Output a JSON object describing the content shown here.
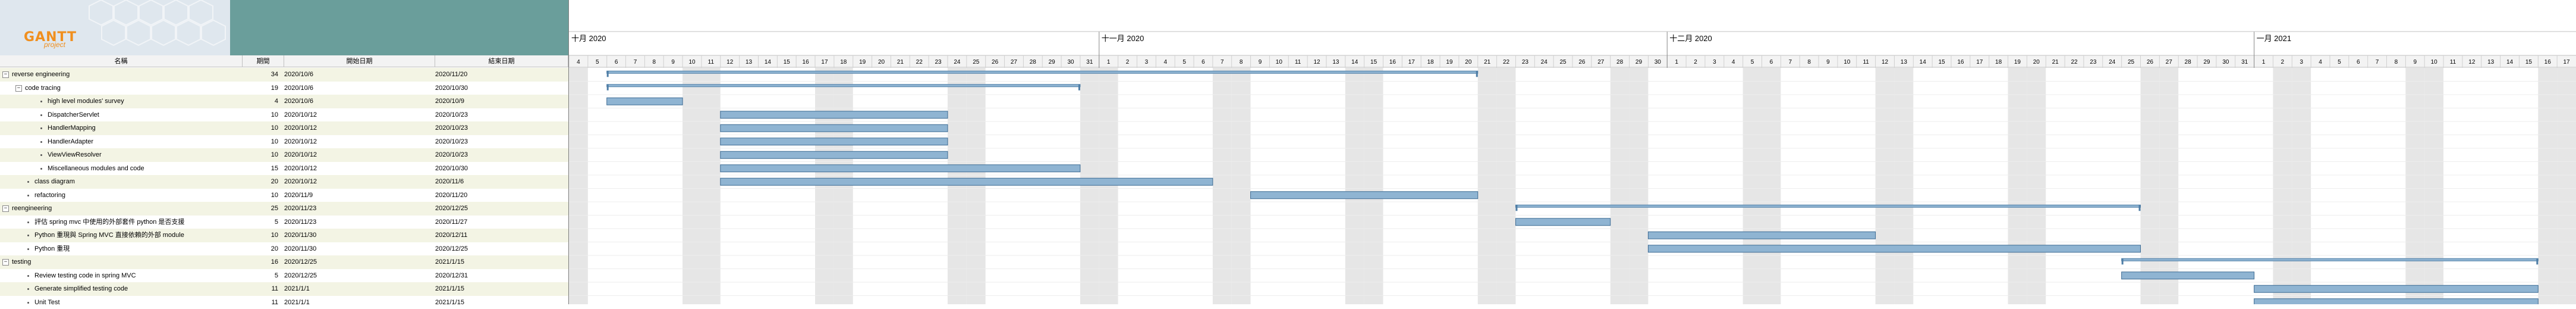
{
  "logo": {
    "brand": "GANTT",
    "sub": "project"
  },
  "columns": {
    "task": "名稱",
    "duration": "期間",
    "start": "開始日期",
    "end": "結束日期"
  },
  "timeline": {
    "start_date": "2020-10-04",
    "end_date": "2021-01-17",
    "months": [
      "十月 2020",
      "十一月 2020",
      "十二月 2020",
      "一月 2021"
    ],
    "weekend_color": "#e6e6e6",
    "bar_color": "#8fb4d2"
  },
  "tasks": [
    {
      "name": "reverse engineering",
      "duration": "34",
      "start": "2020/10/6",
      "end": "2020/11/20",
      "level": 0,
      "type": "summary",
      "toggle": "−"
    },
    {
      "name": "code tracing",
      "duration": "19",
      "start": "2020/10/6",
      "end": "2020/10/30",
      "level": 1,
      "type": "summary",
      "toggle": "−"
    },
    {
      "name": "high level modules' survey",
      "duration": "4",
      "start": "2020/10/6",
      "end": "2020/10/9",
      "level": 2,
      "type": "task"
    },
    {
      "name": "DispatcherServlet",
      "duration": "10",
      "start": "2020/10/12",
      "end": "2020/10/23",
      "level": 2,
      "type": "task"
    },
    {
      "name": "HandlerMapping",
      "duration": "10",
      "start": "2020/10/12",
      "end": "2020/10/23",
      "level": 2,
      "type": "task"
    },
    {
      "name": "HandlerAdapter",
      "duration": "10",
      "start": "2020/10/12",
      "end": "2020/10/23",
      "level": 2,
      "type": "task"
    },
    {
      "name": "ViewViewResolver",
      "duration": "10",
      "start": "2020/10/12",
      "end": "2020/10/23",
      "level": 2,
      "type": "task"
    },
    {
      "name": "Miscellaneous modules and code",
      "duration": "15",
      "start": "2020/10/12",
      "end": "2020/10/30",
      "level": 2,
      "type": "task"
    },
    {
      "name": "class diagram",
      "duration": "20",
      "start": "2020/10/12",
      "end": "2020/11/6",
      "level": 1,
      "type": "task"
    },
    {
      "name": "refactoring",
      "duration": "10",
      "start": "2020/11/9",
      "end": "2020/11/20",
      "level": 1,
      "type": "task"
    },
    {
      "name": "reengineering",
      "duration": "25",
      "start": "2020/11/23",
      "end": "2020/12/25",
      "level": 0,
      "type": "summary",
      "toggle": "−"
    },
    {
      "name": "評估 spring mvc 中使用的外部套件 python 是否支援",
      "duration": "5",
      "start": "2020/11/23",
      "end": "2020/11/27",
      "level": 1,
      "type": "task"
    },
    {
      "name": "Python 重現與 Spring MVC 直接依賴的外部 module",
      "duration": "10",
      "start": "2020/11/30",
      "end": "2020/12/11",
      "level": 1,
      "type": "task"
    },
    {
      "name": "Python 重現",
      "duration": "20",
      "start": "2020/11/30",
      "end": "2020/12/25",
      "level": 1,
      "type": "task"
    },
    {
      "name": "testing",
      "duration": "16",
      "start": "2020/12/25",
      "end": "2021/1/15",
      "level": 0,
      "type": "summary",
      "toggle": "−"
    },
    {
      "name": "Review testing code in spring MVC",
      "duration": "5",
      "start": "2020/12/25",
      "end": "2020/12/31",
      "level": 1,
      "type": "task"
    },
    {
      "name": "Generate simplified testing code",
      "duration": "11",
      "start": "2021/1/1",
      "end": "2021/1/15",
      "level": 1,
      "type": "task"
    },
    {
      "name": "Unit Test",
      "duration": "11",
      "start": "2021/1/1",
      "end": "2021/1/15",
      "level": 1,
      "type": "task"
    }
  ]
}
